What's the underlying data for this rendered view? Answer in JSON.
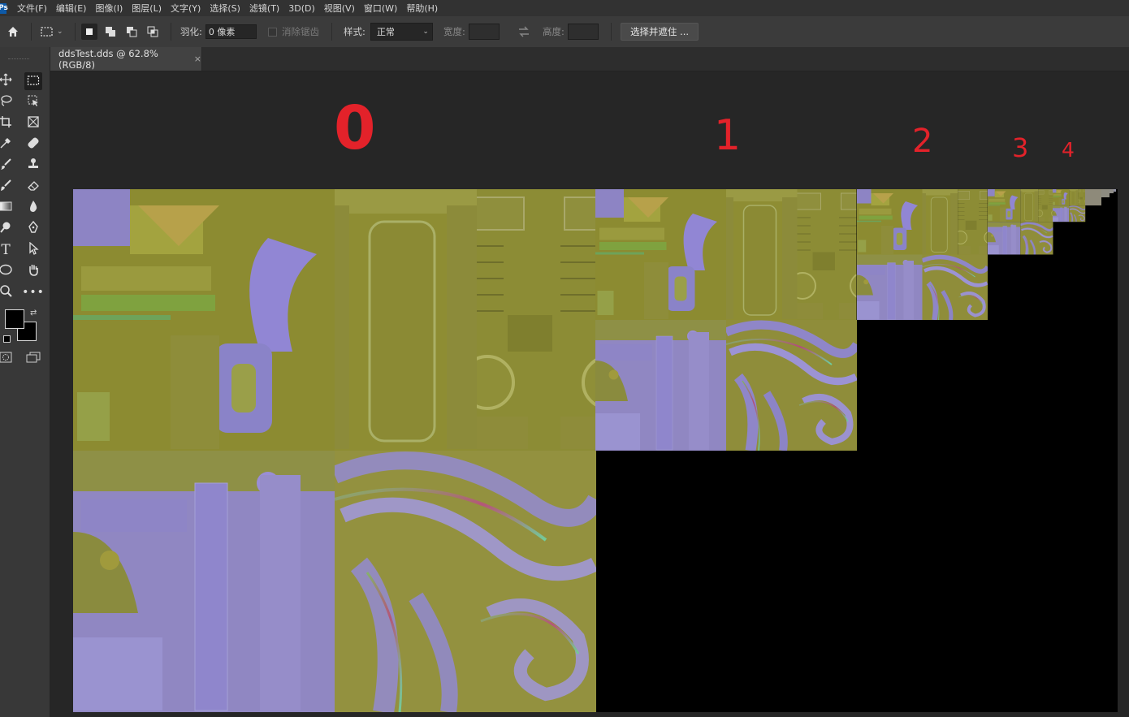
{
  "app": {
    "logo": "Ps",
    "menu": [
      "文件(F)",
      "编辑(E)",
      "图像(I)",
      "图层(L)",
      "文字(Y)",
      "选择(S)",
      "滤镜(T)",
      "3D(D)",
      "视图(V)",
      "窗口(W)",
      "帮助(H)"
    ]
  },
  "options": {
    "feather_label": "羽化:",
    "feather_value": "0 像素",
    "antialias_label": "消除锯齿",
    "style_label": "样式:",
    "style_value": "正常",
    "width_label": "宽度:",
    "height_label": "高度:",
    "select_mask_button": "选择并遮住 ..."
  },
  "document": {
    "tab_title": "ddsTest.dds @ 62.8%(RGB/8)",
    "close_glyph": "×"
  },
  "annotations": [
    "0",
    "1",
    "2",
    "3",
    "4"
  ],
  "colors": {
    "annotation": "#e3222a",
    "normal_map_olive": "#8f8f2e",
    "normal_map_purple": "#8f86c9",
    "empty": "#000000"
  },
  "icons": {
    "home": "home-icon",
    "marquee": "rect-marquee-icon",
    "move": "move-icon",
    "lasso": "lasso-icon",
    "crop": "crop-icon",
    "eyedropper": "eyedropper-icon",
    "brush": "brush-icon",
    "text": "text-tool-icon",
    "zoom": "zoom-icon"
  }
}
